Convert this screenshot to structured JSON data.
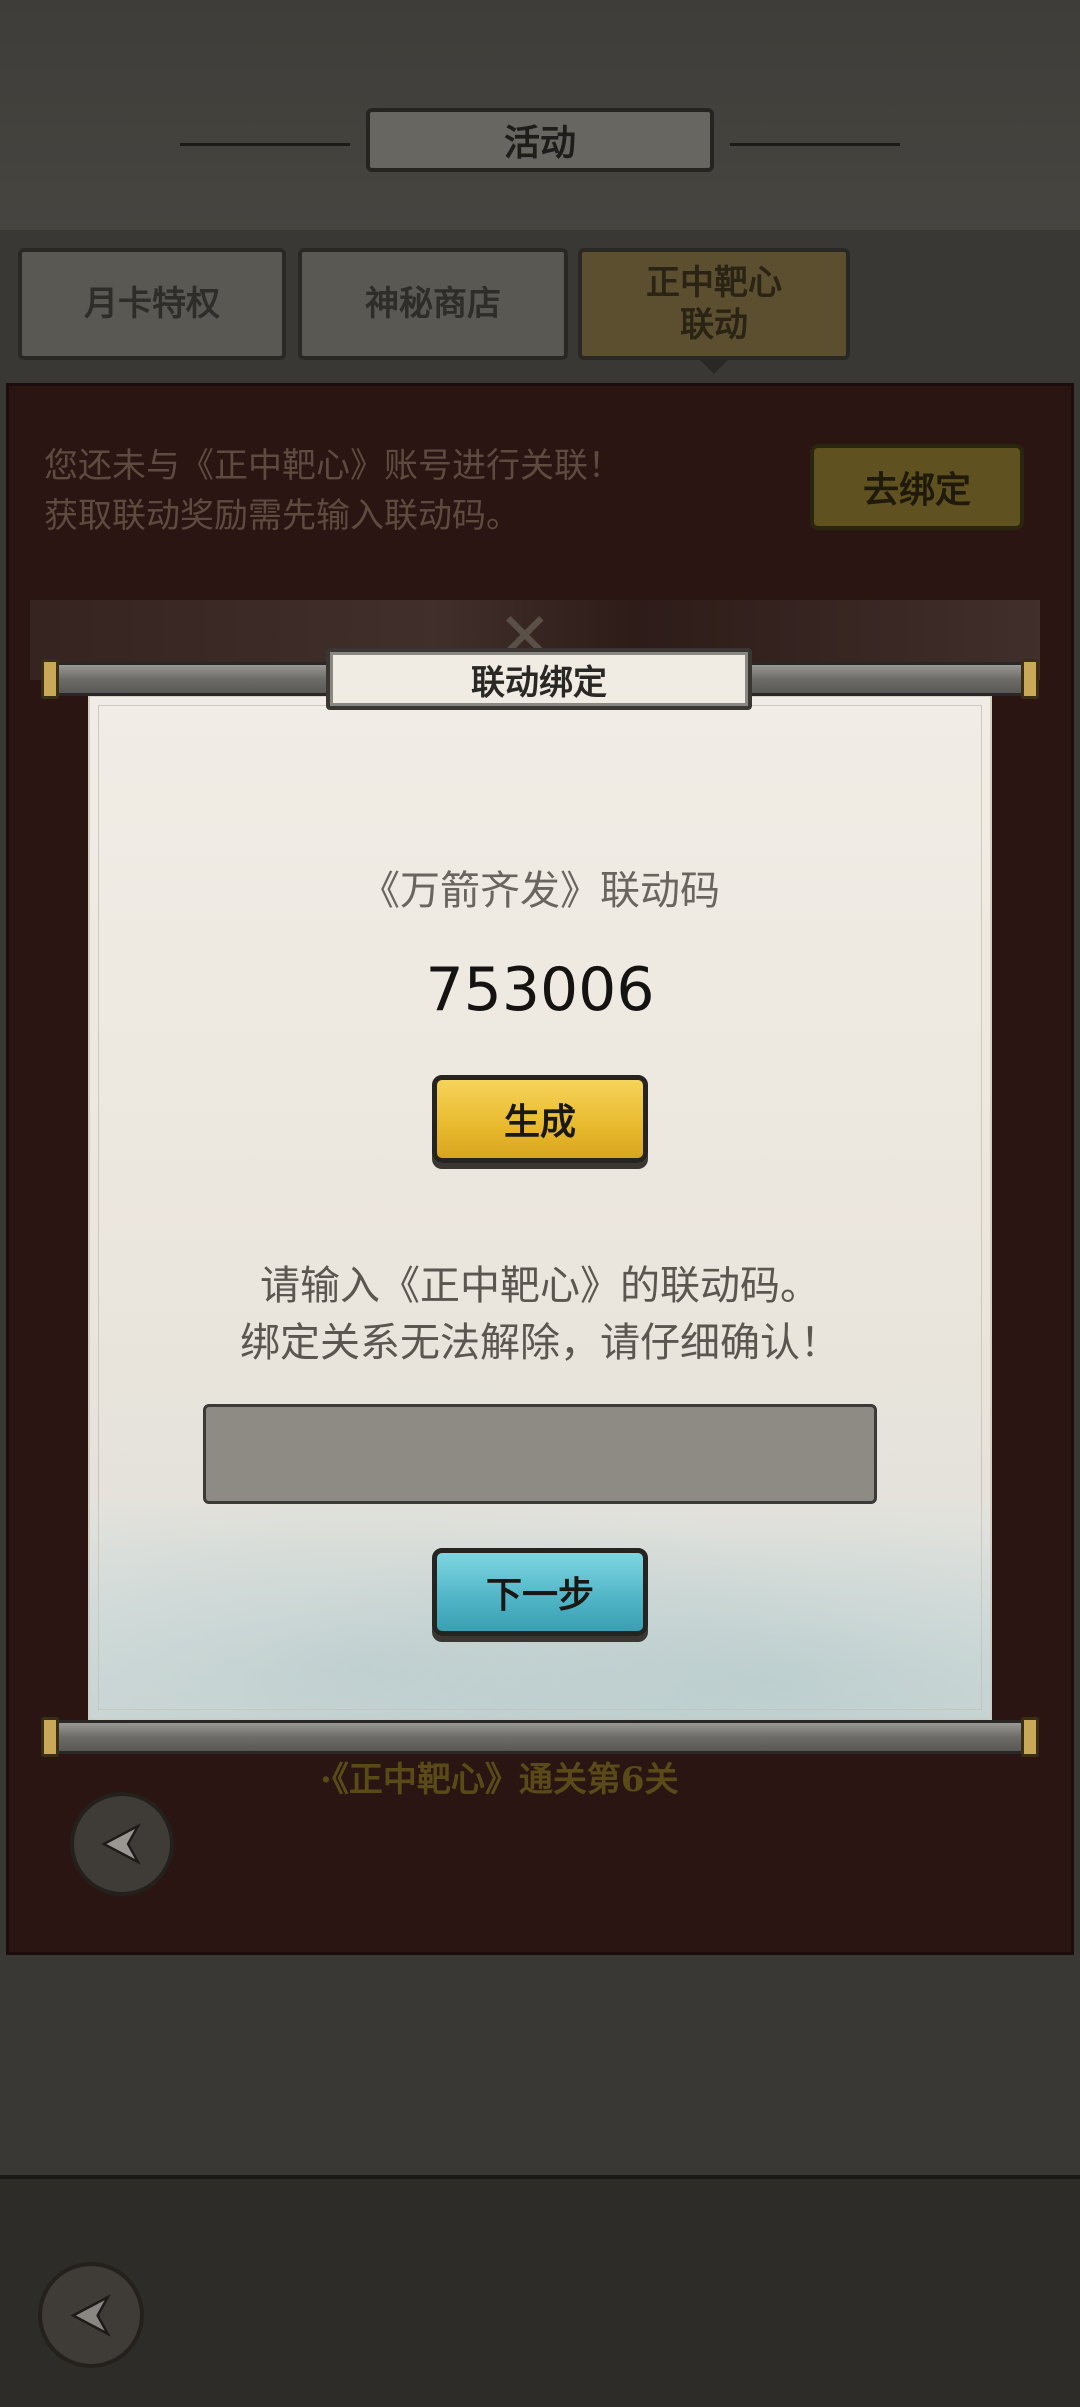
{
  "header": {
    "title": "活动"
  },
  "tabs": [
    {
      "label": "月卡特权"
    },
    {
      "label": "神秘商店"
    },
    {
      "label_line1": "正中靶心",
      "label_line2": "联动"
    }
  ],
  "event": {
    "notice_line1": "您还未与《正中靶心》账号进行关联！",
    "notice_line2": "获取联动奖励需先输入联动码。",
    "bind_button": "去绑定",
    "requirement": "·《正中靶心》通关第6关"
  },
  "dialog": {
    "title": "联动绑定",
    "code_label": "《万箭齐发》联动码",
    "code_value": "753006",
    "generate_button": "生成",
    "instruction_line1": "请输入《正中靶心》的联动码。",
    "instruction_line2": "绑定关系无法解除，请仔细确认！",
    "input_value": "",
    "input_placeholder": "",
    "next_button": "下一步"
  },
  "icons": {
    "back": "back-arrow-icon"
  }
}
